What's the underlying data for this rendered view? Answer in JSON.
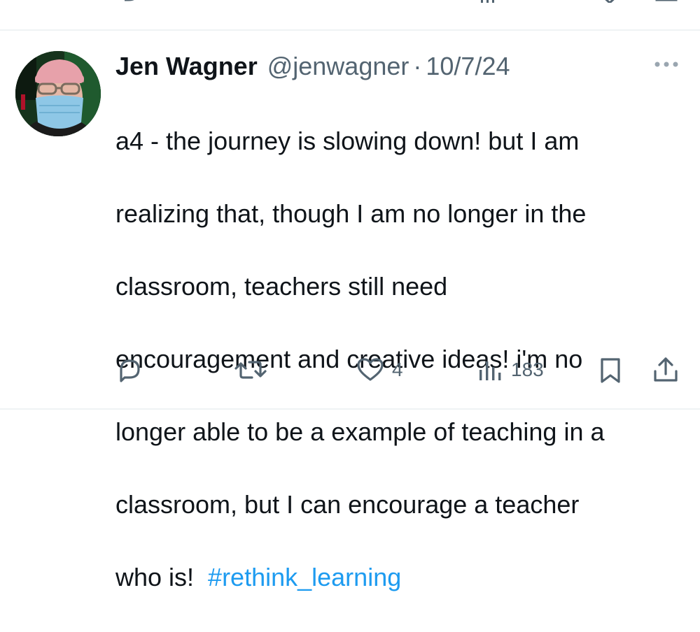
{
  "tweet": {
    "author_name": "Jen Wagner",
    "author_handle": "@jenwagner",
    "separator": "·",
    "date": "10/7/24",
    "text_lines": [
      "a4 - the journey is slowing down!  but I am",
      "realizing that, though I am no longer in the",
      "classroom, teachers still need",
      "encouragement and creative ideas!  i'm no",
      "longer able to be a example of teaching in a",
      "classroom, but I can encourage a teacher",
      "who is!  "
    ],
    "hashtag": "#rethink_learning"
  },
  "actions": {
    "reply_count": "",
    "repost_count": "",
    "like_count": "4",
    "views_count": "183"
  },
  "icons": {
    "more": "more-dots-icon",
    "reply": "reply-icon",
    "repost": "repost-icon",
    "like": "heart-icon",
    "views": "views-chart-icon",
    "bookmark": "bookmark-icon",
    "share": "share-icon"
  },
  "colors": {
    "text": "#0f1419",
    "secondary": "#536471",
    "link": "#1d9bf0",
    "divider": "#eff3f4"
  }
}
